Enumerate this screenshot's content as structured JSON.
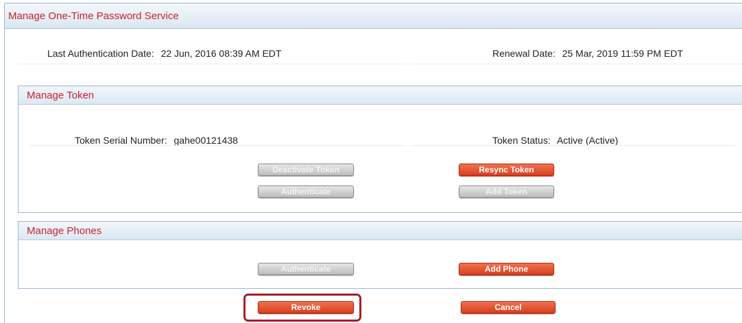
{
  "title": "Manage One-Time Password Service",
  "auth": {
    "last_auth_label": "Last Authentication Date:",
    "last_auth_value": "22 Jun, 2016 08:39 AM EDT",
    "renewal_label": "Renewal Date:",
    "renewal_value": "25 Mar, 2019 11:59 PM EDT"
  },
  "token_panel": {
    "title": "Manage Token",
    "serial_label": "Token Serial Number:",
    "serial_value": "gahe00121438",
    "status_label": "Token Status:",
    "status_value": "Active (Active)",
    "buttons": {
      "deactivate": "Deactivate Token",
      "resync": "Resync Token",
      "authenticate": "Authenticate",
      "add_token": "Add Token"
    }
  },
  "phones_panel": {
    "title": "Manage Phones",
    "buttons": {
      "authenticate": "Authenticate",
      "add_phone": "Add Phone"
    }
  },
  "footer": {
    "revoke": "Revoke",
    "cancel": "Cancel"
  },
  "colors": {
    "accent_text": "#c8232c",
    "primary_button": "#d9401f",
    "disabled_button": "#bdbdbd",
    "highlight_border": "#a0202a"
  }
}
